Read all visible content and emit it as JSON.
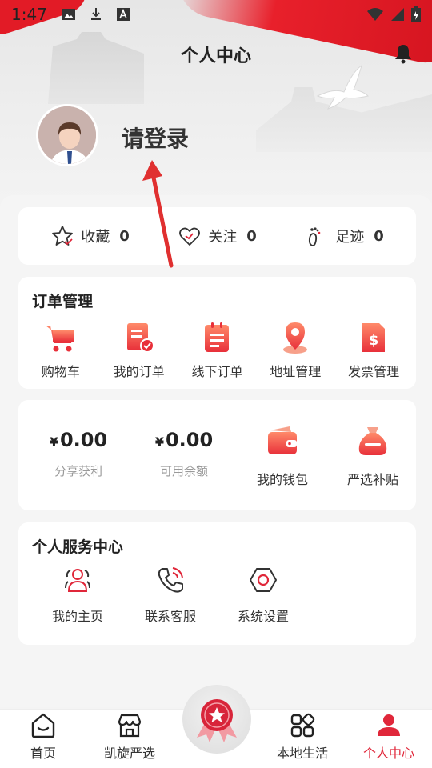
{
  "status_bar": {
    "time": "1:47"
  },
  "header": {
    "title": "个人中心"
  },
  "profile": {
    "login_prompt": "请登录"
  },
  "stats": [
    {
      "label": "收藏",
      "count": "0",
      "icon": "star-icon"
    },
    {
      "label": "关注",
      "count": "0",
      "icon": "heart-icon"
    },
    {
      "label": "足迹",
      "count": "0",
      "icon": "footprint-icon"
    }
  ],
  "orders": {
    "title": "订单管理",
    "items": [
      {
        "label": "购物车",
        "icon": "cart-icon"
      },
      {
        "label": "我的订单",
        "icon": "order-icon"
      },
      {
        "label": "线下订单",
        "icon": "clipboard-icon"
      },
      {
        "label": "地址管理",
        "icon": "location-icon"
      },
      {
        "label": "发票管理",
        "icon": "invoice-icon"
      }
    ]
  },
  "wallet": {
    "share_profit_value": "0.00",
    "share_profit_label": "分享获利",
    "balance_value": "0.00",
    "balance_label": "可用余额",
    "currency": "¥",
    "wallet_label": "我的钱包",
    "subsidy_label": "严选补贴"
  },
  "services": {
    "title": "个人服务中心",
    "items": [
      {
        "label": "我的主页",
        "icon": "users-icon"
      },
      {
        "label": "联系客服",
        "icon": "phone-icon"
      },
      {
        "label": "系统设置",
        "icon": "settings-icon"
      }
    ]
  },
  "bottom_nav": [
    {
      "label": "首页",
      "icon": "home-icon"
    },
    {
      "label": "凯旋严选",
      "icon": "store-icon"
    },
    {
      "label": "",
      "icon": "badge-icon"
    },
    {
      "label": "本地生活",
      "icon": "grid-icon"
    },
    {
      "label": "个人中心",
      "icon": "person-icon"
    }
  ],
  "colors": {
    "accent": "#e0273a",
    "icon_gradient_start": "#ff8a6a",
    "icon_gradient_end": "#e8303a"
  }
}
